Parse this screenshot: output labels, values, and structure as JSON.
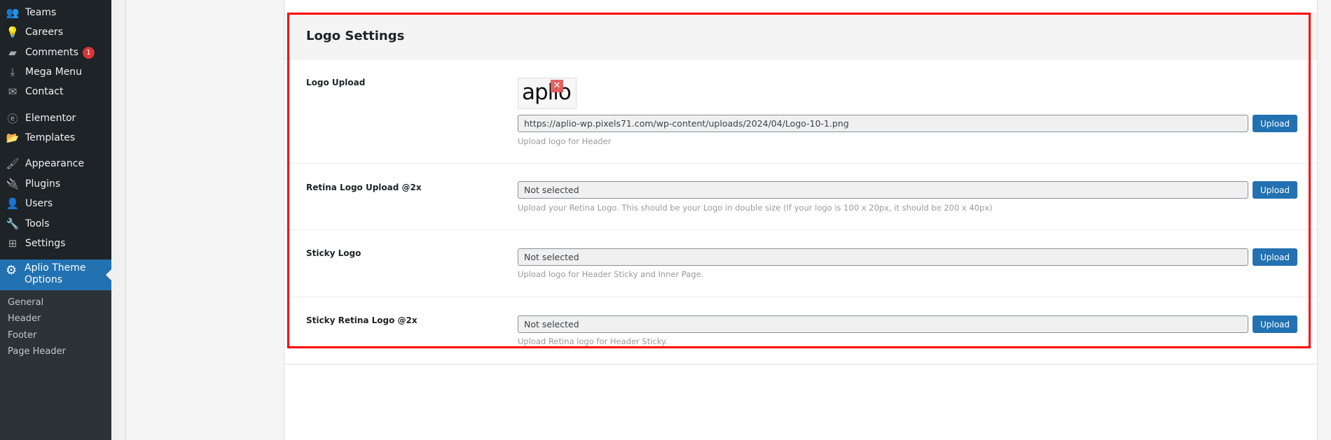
{
  "sidebar": {
    "items": [
      {
        "label": "Teams",
        "icon": "groups-icon"
      },
      {
        "label": "Careers",
        "icon": "lightbulb-icon"
      },
      {
        "label": "Comments",
        "icon": "comment-icon",
        "badge": "1"
      },
      {
        "label": "Mega Menu",
        "icon": "download-icon"
      },
      {
        "label": "Contact",
        "icon": "email-icon"
      },
      {
        "label": "Elementor",
        "icon": "elementor-icon"
      },
      {
        "label": "Templates",
        "icon": "folder-icon"
      },
      {
        "label": "Appearance",
        "icon": "brush-icon"
      },
      {
        "label": "Plugins",
        "icon": "plugin-icon"
      },
      {
        "label": "Users",
        "icon": "user-icon"
      },
      {
        "label": "Tools",
        "icon": "wrench-icon"
      },
      {
        "label": "Settings",
        "icon": "settings-icon"
      }
    ],
    "active": {
      "label": "Aplio Theme Options",
      "icon": "gear-icon"
    },
    "submenu": [
      "General",
      "Header",
      "Footer",
      "Page Header"
    ]
  },
  "panel": {
    "title": "Logo Settings",
    "logo_preview_text": "aplio",
    "fields": [
      {
        "label": "Logo Upload",
        "value": "https://aplio-wp.pixels71.com/wp-content/uploads/2024/04/Logo-10-1.png",
        "button": "Upload",
        "help": "Upload logo for Header"
      },
      {
        "label": "Retina Logo Upload @2x",
        "value": "Not selected",
        "button": "Upload",
        "help": "Upload your Retina Logo. This should be your Logo in double size (If your logo is 100 x 20px, it should be 200 x 40px)"
      },
      {
        "label": "Sticky Logo",
        "value": "Not selected",
        "button": "Upload",
        "help": "Upload logo for Header Sticky and Inner Page."
      },
      {
        "label": "Sticky Retina Logo @2x",
        "value": "Not selected",
        "button": "Upload",
        "help": "Upload Retina logo for Header Sticky."
      }
    ]
  },
  "colors": {
    "accent": "#2271b1",
    "highlight": "#ff0000",
    "sidebar": "#1d2327"
  }
}
